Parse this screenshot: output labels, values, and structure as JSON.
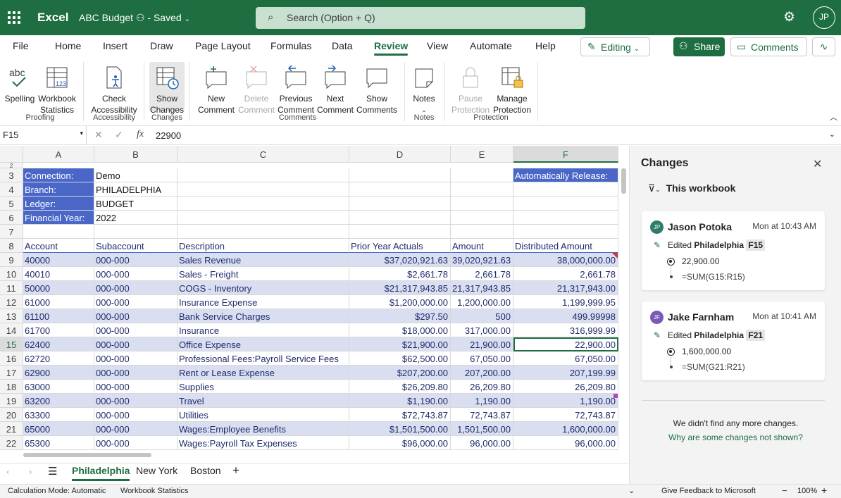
{
  "titlebar": {
    "app": "Excel",
    "doc": "ABC Budget",
    "saved": "Saved",
    "search_placeholder": "Search (Option + Q)",
    "avatar": "JP"
  },
  "menu": [
    "File",
    "Home",
    "Insert",
    "Draw",
    "Page Layout",
    "Formulas",
    "Data",
    "Review",
    "View",
    "Automate",
    "Help"
  ],
  "active_menu": "Review",
  "actions": {
    "editing": "Editing",
    "share": "Share",
    "comments": "Comments"
  },
  "ribbon": {
    "spelling": "Spelling",
    "workbook_stats_1": "Workbook",
    "workbook_stats_2": "Statistics",
    "proofing": "Proofing",
    "check_acc_1": "Check",
    "check_acc_2": "Accessibility",
    "accessibility": "Accessibility",
    "show_changes_1": "Show",
    "show_changes_2": "Changes",
    "changes": "Changes",
    "new_comment_1": "New",
    "new_comment_2": "Comment",
    "delete_comment_1": "Delete",
    "delete_comment_2": "Comment",
    "prev_comment_1": "Previous",
    "prev_comment_2": "Comment",
    "next_comment_1": "Next",
    "next_comment_2": "Comment",
    "show_comments_1": "Show",
    "show_comments_2": "Comments",
    "comments": "Comments",
    "notes_btn": "Notes",
    "notes": "Notes",
    "pause_1": "Pause",
    "pause_2": "Protection",
    "manage_1": "Manage",
    "manage_2": "Protection",
    "protection": "Protection"
  },
  "formula": {
    "namebox": "F15",
    "value": "22900"
  },
  "columns": [
    "A",
    "B",
    "C",
    "D",
    "E",
    "F"
  ],
  "top_rows": [
    {
      "n": "3",
      "a": "Connection:",
      "b": "Demo",
      "f": "Automatically Release:"
    },
    {
      "n": "4",
      "a": "Branch:",
      "b": "PHILADELPHIA",
      "f": ""
    },
    {
      "n": "5",
      "a": "Ledger:",
      "b": "BUDGET",
      "f": ""
    },
    {
      "n": "6",
      "a": "Financial Year:",
      "b": "2022",
      "f": ""
    },
    {
      "n": "7",
      "a": "",
      "b": "",
      "f": ""
    }
  ],
  "header_row": {
    "n": "8",
    "cols": [
      "Account",
      "Subaccount",
      "Description",
      "Prior Year Actuals",
      "Amount",
      "Distributed Amount"
    ]
  },
  "rows": [
    {
      "n": "9",
      "a": "40000",
      "b": "000-000",
      "c": "Sales Revenue",
      "d": "$37,020,921.63",
      "e": "39,020,921.63",
      "f": "38,000,000.00"
    },
    {
      "n": "10",
      "a": "40010",
      "b": "000-000",
      "c": "Sales - Freight",
      "d": "$2,661.78",
      "e": "2,661.78",
      "f": "2,661.78"
    },
    {
      "n": "11",
      "a": "50000",
      "b": "000-000",
      "c": "COGS - Inventory",
      "d": "$21,317,943.85",
      "e": "21,317,943.85",
      "f": "21,317,943.00"
    },
    {
      "n": "12",
      "a": "61000",
      "b": "000-000",
      "c": "Insurance Expense",
      "d": "$1,200,000.00",
      "e": "1,200,000.00",
      "f": "1,199,999.95"
    },
    {
      "n": "13",
      "a": "61100",
      "b": "000-000",
      "c": "Bank Service Charges",
      "d": "$297.50",
      "e": "500",
      "f": "499.99998"
    },
    {
      "n": "14",
      "a": "61700",
      "b": "000-000",
      "c": "Insurance",
      "d": "$18,000.00",
      "e": "317,000.00",
      "f": "316,999.99"
    },
    {
      "n": "15",
      "a": "62400",
      "b": "000-000",
      "c": "Office Expense",
      "d": "$21,900.00",
      "e": "21,900.00",
      "f": "22,900.00"
    },
    {
      "n": "16",
      "a": "62720",
      "b": "000-000",
      "c": "Professional Fees:Payroll Service Fees",
      "d": "$62,500.00",
      "e": "67,050.00",
      "f": "67,050.00"
    },
    {
      "n": "17",
      "a": "62900",
      "b": "000-000",
      "c": "Rent or Lease Expense",
      "d": "$207,200.00",
      "e": "207,200.00",
      "f": "207,199.99"
    },
    {
      "n": "18",
      "a": "63000",
      "b": "000-000",
      "c": "Supplies",
      "d": "$26,209.80",
      "e": "26,209.80",
      "f": "26,209.80"
    },
    {
      "n": "19",
      "a": "63200",
      "b": "000-000",
      "c": "Travel",
      "d": "$1,190.00",
      "e": "1,190.00",
      "f": "1,190.00"
    },
    {
      "n": "20",
      "a": "63300",
      "b": "000-000",
      "c": "Utilities",
      "d": "$72,743.87",
      "e": "72,743.87",
      "f": "72,743.87"
    },
    {
      "n": "21",
      "a": "65000",
      "b": "000-000",
      "c": "Wages:Employee Benefits",
      "d": "$1,501,500.00",
      "e": "1,501,500.00",
      "f": "1,600,000.00"
    },
    {
      "n": "22",
      "a": "65300",
      "b": "000-000",
      "c": "Wages:Payroll Tax Expenses",
      "d": "$96,000.00",
      "e": "96,000.00",
      "f": "96,000.00"
    }
  ],
  "sheets": [
    "Philadelphia",
    "New York",
    "Boston"
  ],
  "active_sheet": "Philadelphia",
  "status": {
    "calc": "Calculation Mode: Automatic",
    "stats": "Workbook Statistics",
    "feedback": "Give Feedback to Microsoft",
    "zoom": "100%"
  },
  "panel": {
    "title": "Changes",
    "filter": "This workbook",
    "cards": [
      {
        "initials": "JP",
        "name": "Jason Potoka",
        "time": "Mon at 10:43 AM",
        "edited": "Edited",
        "sheet": "Philadelphia",
        "ref": "F15",
        "value": "22,900.00",
        "formula": "=SUM(G15:R15)",
        "color": "#2f7d6a"
      },
      {
        "initials": "JF",
        "name": "Jake Farnham",
        "time": "Mon at 10:41 AM",
        "edited": "Edited",
        "sheet": "Philadelphia",
        "ref": "F21",
        "value": "1,600,000.00",
        "formula": "=SUM(G21:R21)",
        "color": "#7a5ab8"
      }
    ],
    "no_more": "We didn't find any more changes.",
    "why_link": "Why are some changes not shown?"
  }
}
